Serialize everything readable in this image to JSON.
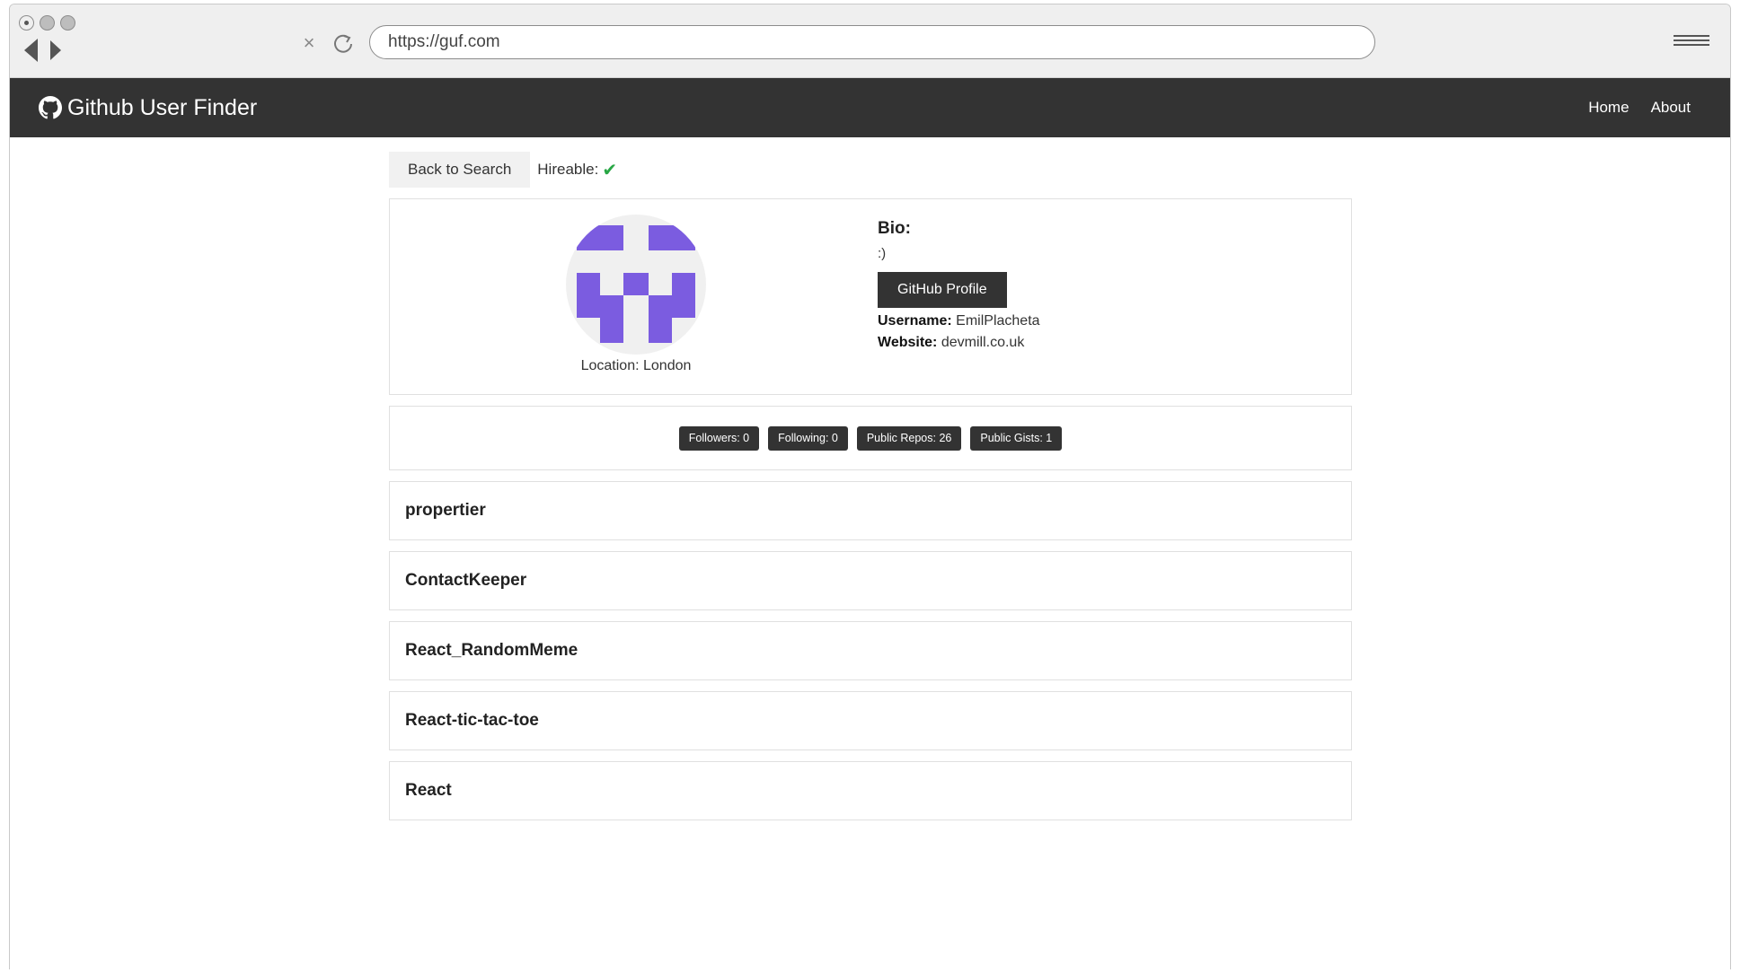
{
  "browser": {
    "url": "https://guf.com"
  },
  "navbar": {
    "brand": "Github User Finder",
    "links": [
      "Home",
      "About"
    ]
  },
  "user": {
    "back_label": "Back to Search",
    "hireable_label": "Hireable:",
    "hireable": true,
    "location": "Location: London",
    "bio_label": "Bio:",
    "bio": ":)",
    "profile_button": "GitHub Profile",
    "username_label": "Username:",
    "username": "EmilPlacheta",
    "website_label": "Website:",
    "website": "devmill.co.uk"
  },
  "stats": [
    "Followers: 0",
    "Following: 0",
    "Public Repos: 26",
    "Public Gists: 1"
  ],
  "repos": [
    "propertier",
    "ContactKeeper",
    "React_RandomMeme",
    "React-tic-tac-toe",
    "React"
  ],
  "colors": {
    "navbar": "#333333",
    "avatar": "#7b5ce0",
    "check": "#28a745"
  },
  "icons": {
    "brand": "github-icon",
    "hireable": "check-icon"
  }
}
